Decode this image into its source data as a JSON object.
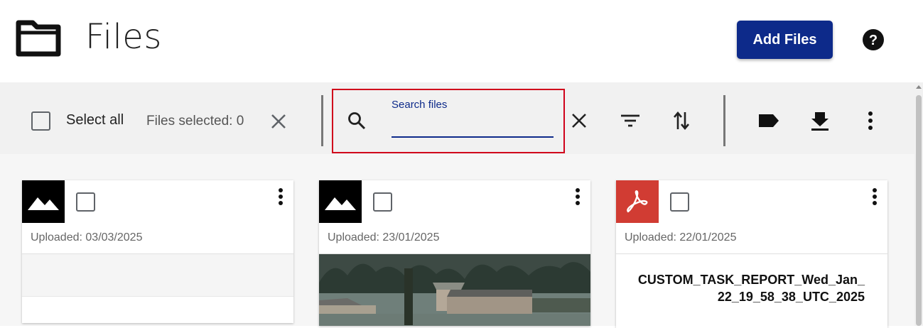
{
  "header": {
    "title": "Files",
    "add_button": "Add Files",
    "icons": {
      "folder": "folder-icon",
      "help": "help-icon"
    }
  },
  "toolbar": {
    "select_all_label": "Select all",
    "files_selected_label": "Files selected: 0",
    "search": {
      "label": "Search files",
      "value": "",
      "placeholder": ""
    },
    "icons": [
      "clear-selection-icon",
      "search-icon",
      "clear-search-icon",
      "filter-icon",
      "sort-icon",
      "tag-icon",
      "download-icon",
      "more-icon"
    ]
  },
  "colors": {
    "primary": "#0d2a8a",
    "highlight_border": "#d0021b",
    "pdf_tile": "#d13c33"
  },
  "cards": [
    {
      "type": "image",
      "uploaded": "Uploaded: 03/03/2025",
      "preview": "blank"
    },
    {
      "type": "image",
      "uploaded": "Uploaded: 23/01/2025",
      "preview": "flooded-houses-photo"
    },
    {
      "type": "pdf",
      "uploaded": "Uploaded: 22/01/2025",
      "title": "CUSTOM_TASK_REPORT_Wed_Jan_22_19_58_38_UTC_2025"
    }
  ]
}
